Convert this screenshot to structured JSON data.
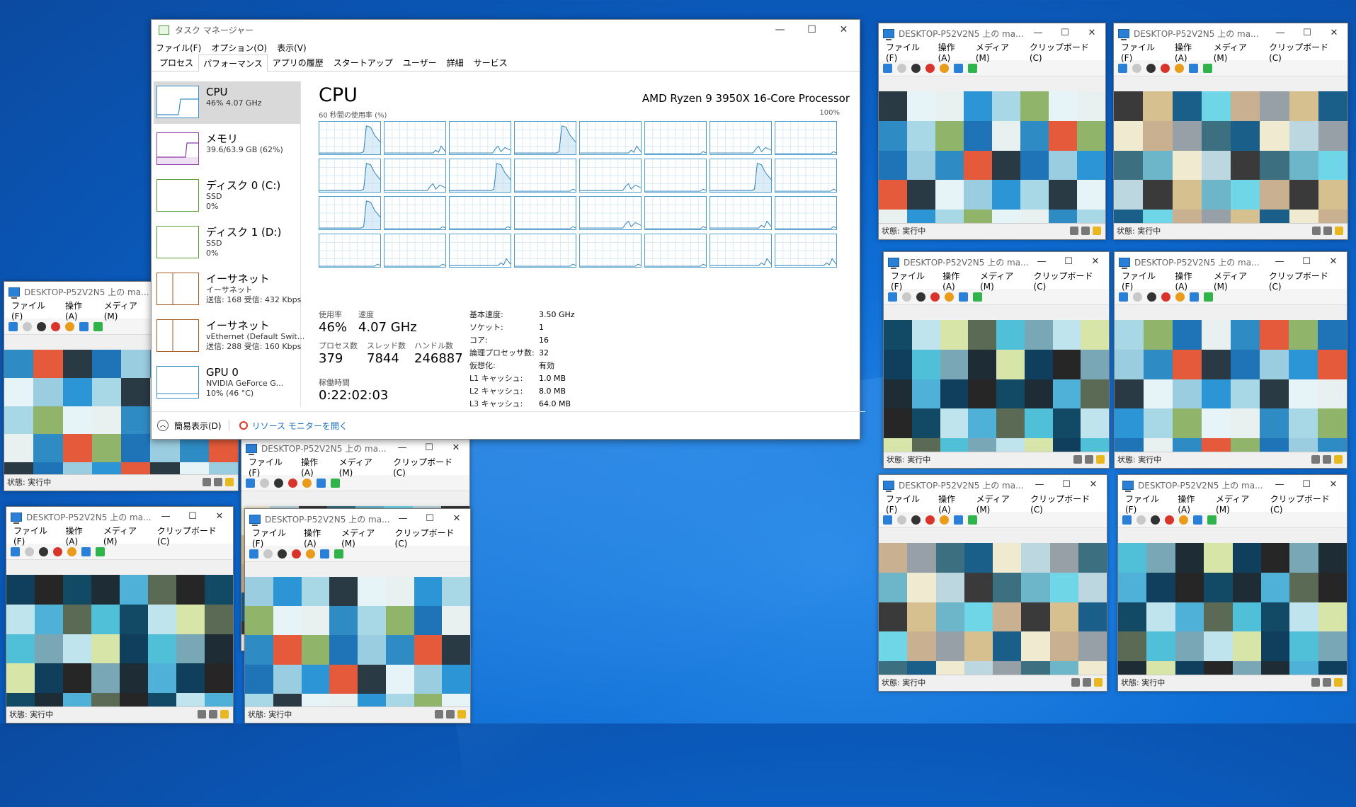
{
  "colors": {
    "accent": "#4b9fd0",
    "graph_line": "#2a7fb8",
    "desktop": "#0f6fd6"
  },
  "taskmanager": {
    "title": "タスク マネージャー",
    "menu": [
      "ファイル(F)",
      "オプション(O)",
      "表示(V)"
    ],
    "tabs": [
      "プロセス",
      "パフォーマンス",
      "アプリの履歴",
      "スタートアップ",
      "ユーザー",
      "詳細",
      "サービス"
    ],
    "sidebar": [
      {
        "name": "CPU",
        "d1": "46%  4.07 GHz",
        "d2": "",
        "d3": "",
        "color": "#3a8fc8"
      },
      {
        "name": "メモリ",
        "d1": "39.6/63.9 GB (62%)",
        "d2": "",
        "d3": "",
        "color": "#8b3fa8"
      },
      {
        "name": "ディスク 0 (C:)",
        "d1": "SSD",
        "d2": "0%",
        "d3": "",
        "color": "#5b9a2e"
      },
      {
        "name": "ディスク 1 (D:)",
        "d1": "SSD",
        "d2": "0%",
        "d3": "",
        "color": "#5b9a2e"
      },
      {
        "name": "イーサネット",
        "d1": "イーサネット",
        "d2": "送信: 168 受信: 432 Kbps",
        "d3": "",
        "color": "#a55a22"
      },
      {
        "name": "イーサネット",
        "d1": "vEthernet (Default Swit...",
        "d2": "送信: 288 受信: 160 Kbps",
        "d3": "",
        "color": "#a55a22"
      },
      {
        "name": "GPU 0",
        "d1": "NVIDIA GeForce G...",
        "d2": "10% (46 °C)",
        "d3": "",
        "color": "#3a8fc8"
      }
    ],
    "cpu": {
      "title": "CPU",
      "processor": "AMD Ryzen 9 3950X 16-Core Processor",
      "graph_label": "60 秒間の使用率 (%)",
      "graph_max": "100%",
      "usage_label": "使用率",
      "usage": "46%",
      "speed_label": "速度",
      "speed": "4.07 GHz",
      "proc_label": "プロセス数",
      "proc": "379",
      "thread_label": "スレッド数",
      "thread": "7844",
      "handle_label": "ハンドル数",
      "handle": "246887",
      "uptime_label": "稼働時間",
      "uptime": "0:22:02:03",
      "kv": [
        [
          "基本速度:",
          "3.50 GHz"
        ],
        [
          "ソケット:",
          "1"
        ],
        [
          "コア:",
          "16"
        ],
        [
          "論理プロセッサ数:",
          "32"
        ],
        [
          "仮想化:",
          "有効"
        ],
        [
          "L1 キャッシュ:",
          "1.0 MB"
        ],
        [
          "L2 キャッシュ:",
          "8.0 MB"
        ],
        [
          "L3 キャッシュ:",
          "64.0 MB"
        ]
      ]
    },
    "footer": {
      "fewer": "簡易表示(D)",
      "resmon": "リソース モニターを開く"
    }
  },
  "vm": {
    "title": "DESKTOP-P52V2N5 上の ma...",
    "menu": [
      "ファイル(F)",
      "操作(A)",
      "メディア(M)",
      "クリップボード(C)"
    ],
    "status": "状態: 実行中"
  }
}
